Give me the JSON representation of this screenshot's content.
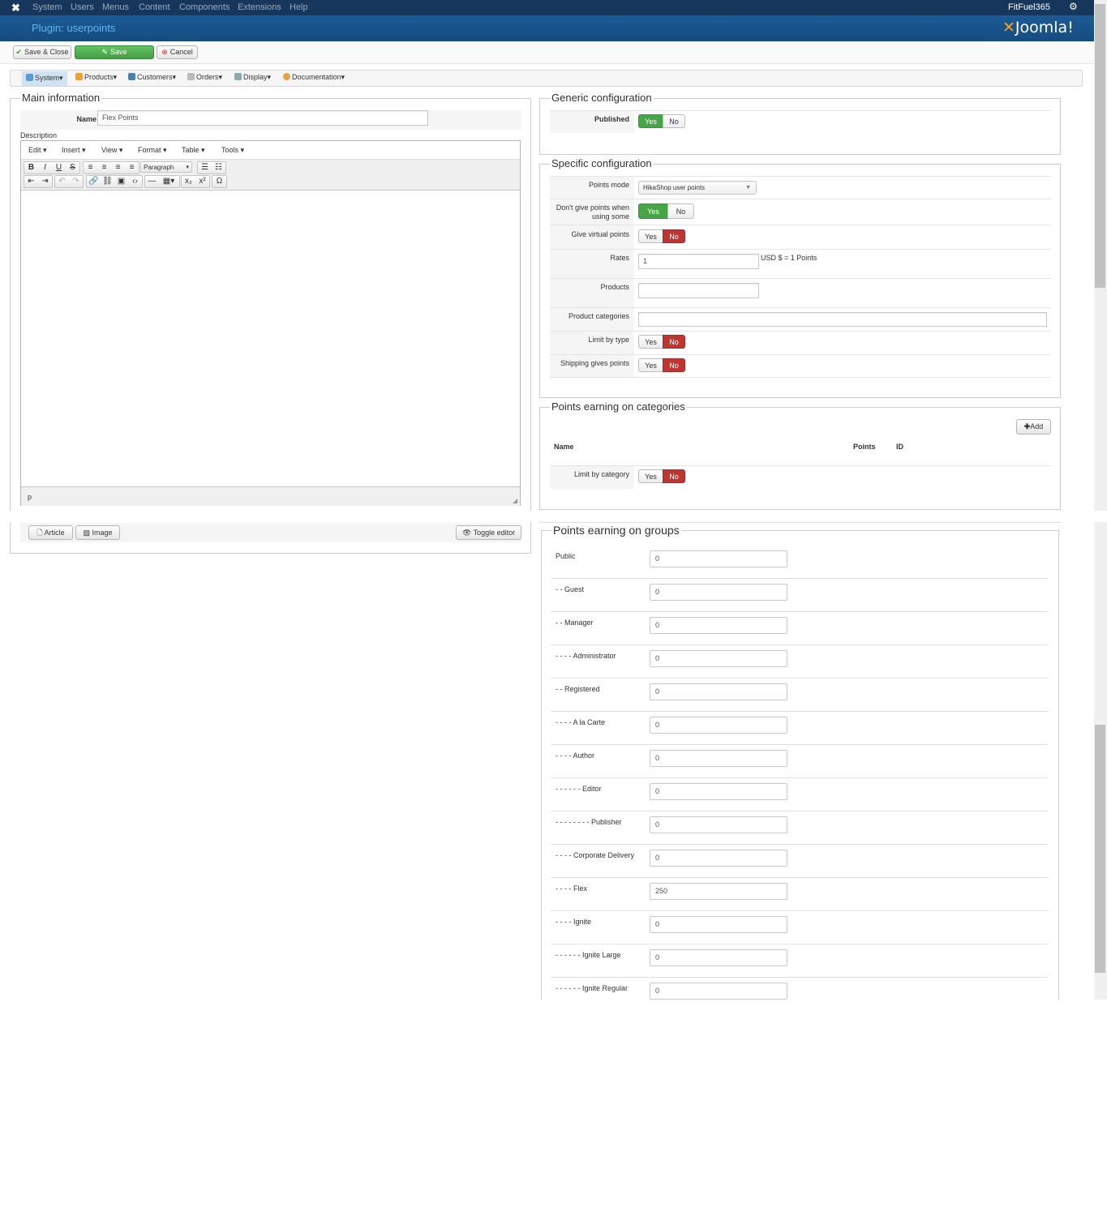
{
  "topnav": {
    "logo_glyph": "✖",
    "items": [
      "System",
      "Users",
      "Menus",
      "Content",
      "Components",
      "Extensions",
      "Help"
    ],
    "user": "FitFuel365",
    "gear": "⚙"
  },
  "header": {
    "title": "Plugin: userpoints",
    "brand": "Joomla!"
  },
  "toolbar": {
    "save_close": "Save & Close",
    "save": "Save",
    "cancel": "Cancel"
  },
  "menubar": {
    "items": [
      "System",
      "Products",
      "Customers",
      "Orders",
      "Display",
      "Documentation"
    ]
  },
  "main_info": {
    "legend": "Main information",
    "name_label": "Name",
    "name_value": "Flex Points",
    "description_label": "Description",
    "editor": {
      "menus": [
        "Edit",
        "Insert",
        "View",
        "Format",
        "Table",
        "Tools"
      ],
      "format_select": "Paragraph",
      "status_path": "p",
      "buttons": {
        "article": "Article",
        "image": "Image",
        "toggle": "Toggle editor"
      }
    }
  },
  "generic": {
    "legend": "Generic configuration",
    "published_label": "Published",
    "published": "Yes"
  },
  "specific": {
    "legend": "Specific configuration",
    "points_mode_label": "Points mode",
    "points_mode_value": "HikaShop user points",
    "dont_give_label": "Don't give points when using some",
    "dont_give": "Yes",
    "virtual_label": "Give virtual points",
    "virtual": "No",
    "rates_label": "Rates",
    "rates_value": "1",
    "rates_suffix": "USD $ = 1 Points",
    "products_label": "Products",
    "product_categories_label": "Product categories",
    "limit_type_label": "Limit by type",
    "limit_type": "No",
    "shipping_label": "Shipping gives points",
    "shipping": "No"
  },
  "categories": {
    "legend": "Points earning on categories",
    "add_label": "Add",
    "columns": [
      "Name",
      "Points",
      "ID"
    ],
    "limit_label": "Limit by category",
    "limit": "No"
  },
  "groups": {
    "legend": "Points earning on groups",
    "rows": [
      {
        "label": "Public",
        "value": "0"
      },
      {
        "label": "- - Guest",
        "value": "0"
      },
      {
        "label": "- - Manager",
        "value": "0"
      },
      {
        "label": "- - - - Administrator",
        "value": "0"
      },
      {
        "label": "- - Registered",
        "value": "0"
      },
      {
        "label": "- - - - A la Carte",
        "value": "0"
      },
      {
        "label": "- - - - Author",
        "value": "0"
      },
      {
        "label": "- - - - - - Editor",
        "value": "0"
      },
      {
        "label": "- - - - - - - - Publisher",
        "value": "0"
      },
      {
        "label": "- - - - Corporate Delivery",
        "value": "0"
      },
      {
        "label": "- - - - Flex",
        "value": "250"
      },
      {
        "label": "- - - - Ignite",
        "value": "0"
      },
      {
        "label": "- - - - - - Ignite Large",
        "value": "0"
      },
      {
        "label": "- - - - - - Ignite Regular",
        "value": "0"
      }
    ]
  },
  "yes_label": "Yes",
  "no_label": "No"
}
